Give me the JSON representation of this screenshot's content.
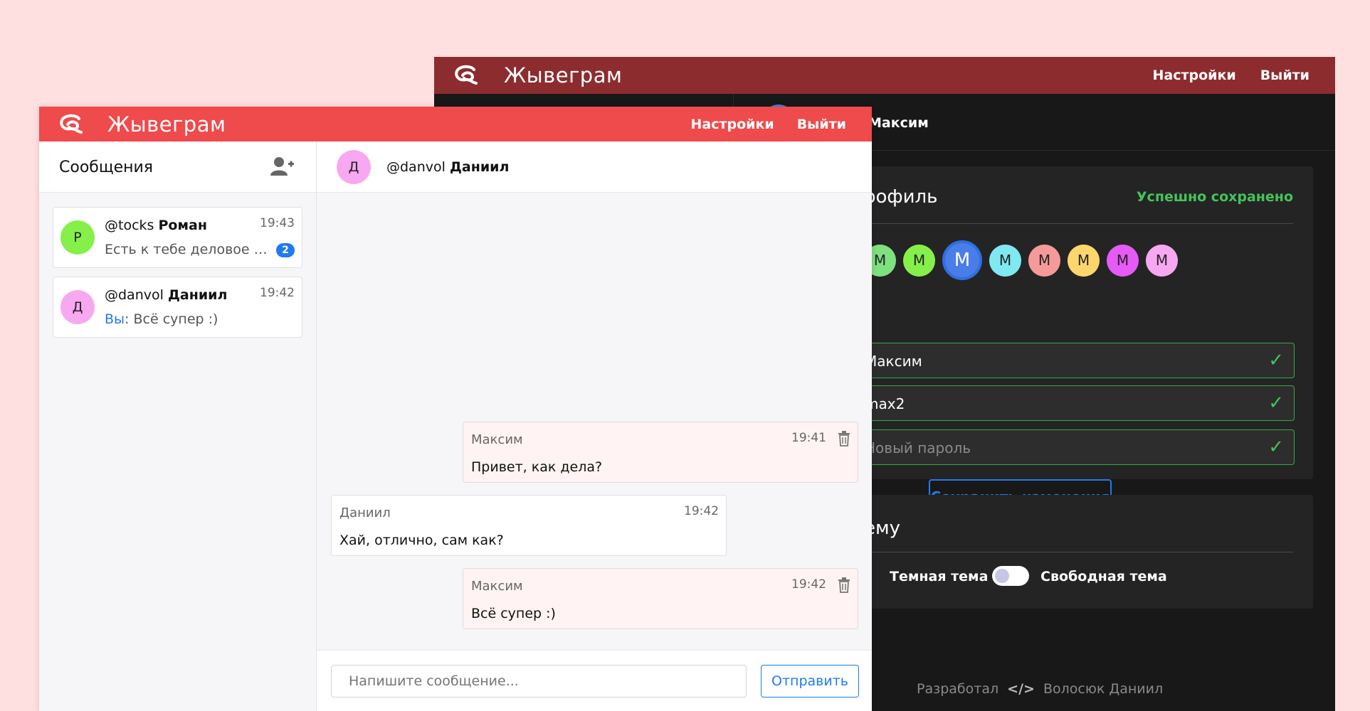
{
  "dark_window": {
    "brand": "Жывеграм",
    "nav": {
      "settings": "Настройки",
      "logout": "Выйти"
    },
    "chat_header_name": "Максим",
    "profile": {
      "title": "рофиль",
      "saved_status": "Успешно сохранено",
      "color_labels": [
        "М",
        "М",
        "М",
        "М",
        "М",
        "М",
        "М",
        "М"
      ],
      "colors": [
        "#7fe07f",
        "#86f04a",
        "#4a7de8",
        "#7fe8f0",
        "#f59a9a",
        "#ffd66b",
        "#e65af5",
        "#f7a8f0"
      ],
      "name_value": "Максим",
      "login_value": "max2",
      "password_placeholder": "Новый пароль",
      "save_button": "Сохранить изменения"
    },
    "theme": {
      "title": "ему",
      "left_label": "Темная тема",
      "right_label": "Свободная тема"
    },
    "footer": {
      "prefix": "Разработал",
      "author": "Волосюк Даниил"
    }
  },
  "light_window": {
    "brand": "Жывеграм",
    "nav": {
      "settings": "Настройки",
      "logout": "Выйти"
    },
    "sidebar": {
      "title": "Сообщения",
      "conversations": [
        {
          "avatar": "Р",
          "avatar_color": "#86f04a",
          "username": "@tocks",
          "name": "Роман",
          "time": "19:43",
          "preview": "Есть к тебе деловое предложение",
          "preview_prefix": "",
          "unread": "2"
        },
        {
          "avatar": "Д",
          "avatar_color": "#f7a8f0",
          "username": "@danvol",
          "name": "Даниил",
          "time": "19:42",
          "preview": "Всё супер :)",
          "preview_prefix": "Вы",
          "unread": ""
        }
      ]
    },
    "chat": {
      "avatar": "Д",
      "username": "@danvol",
      "name": "Даниил",
      "messages": [
        {
          "author": "Максим",
          "time": "19:41",
          "text": "Привет, как дела?",
          "outgoing": true
        },
        {
          "author": "Даниил",
          "time": "19:42",
          "text": "Хай, отлично, сам как?",
          "outgoing": false
        },
        {
          "author": "Максим",
          "time": "19:42",
          "text": "Всё супер :)",
          "outgoing": true
        }
      ],
      "input_placeholder": "Напишите сообщение...",
      "send_button": "Отправить"
    }
  }
}
